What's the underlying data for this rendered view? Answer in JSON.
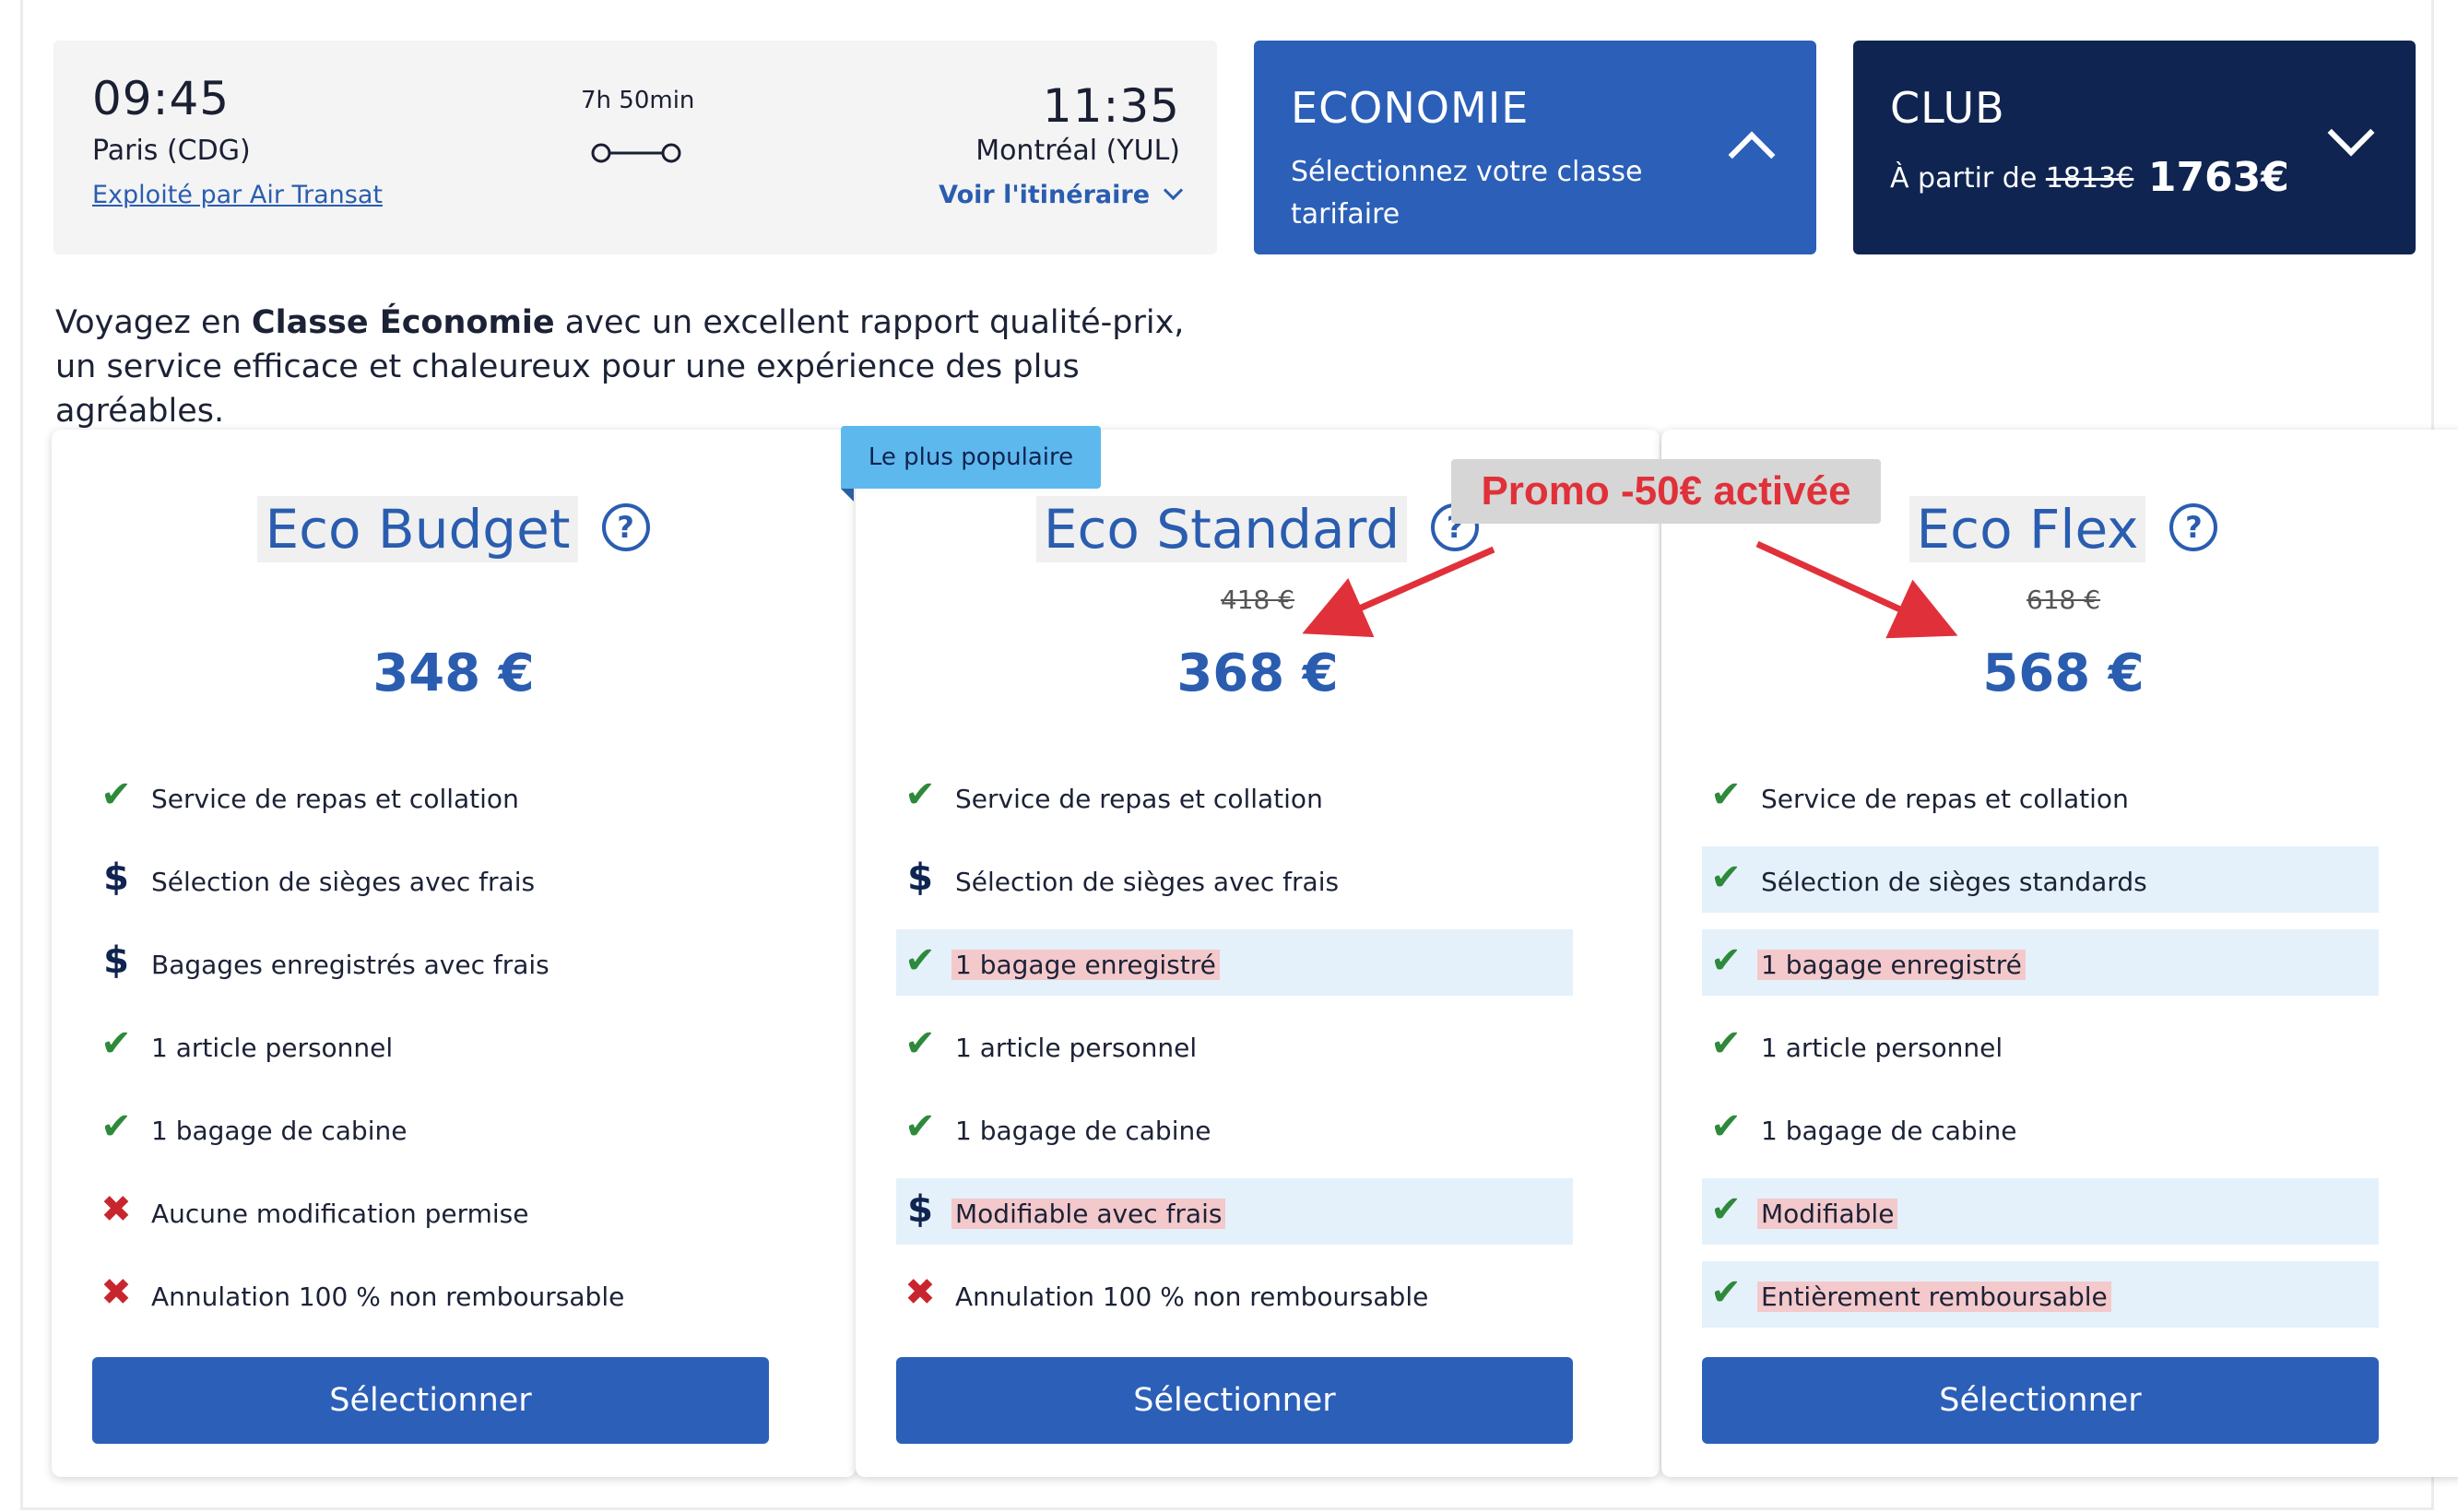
{
  "flight": {
    "departure_time": "09:45",
    "departure_city": "Paris (CDG)",
    "operated_by": "Exploité par Air Transat",
    "duration": "7h 50min",
    "arrival_time": "11:35",
    "arrival_city": "Montréal (YUL)",
    "itinerary_link": "Voir l'itinéraire"
  },
  "tabs": {
    "economy": {
      "title": "ECONOMIE",
      "subtitle": "Sélectionnez votre classe tarifaire",
      "expanded": true
    },
    "club": {
      "title": "CLUB",
      "prefix": "À partir de",
      "old_price": "1813€",
      "price": "1763€",
      "expanded": false
    }
  },
  "description": {
    "before": "Voyagez en ",
    "bold": "Classe Économie",
    "after": " avec un excellent rapport qualité-prix, un service efficace et chaleureux pour une expérience des plus agréables."
  },
  "badge": "Le plus populaire",
  "promo_annotation": "Promo -50€ activée",
  "select_label": "Sélectionner",
  "colors": {
    "primary": "#2b5fb8",
    "navy": "#0f2450",
    "check": "#2e8a3b",
    "cross": "#c8262e",
    "highlight": "#e4f1fa",
    "badge": "#5db8ee",
    "promo": "#e0313a"
  },
  "fares": [
    {
      "name": "Eco Budget",
      "old_price": "",
      "price": "348 €",
      "features": [
        {
          "icon": "check",
          "text": "Service de repas et collation",
          "highlight": false,
          "mark": false
        },
        {
          "icon": "dollar",
          "text": "Sélection de sièges avec frais",
          "highlight": false,
          "mark": false
        },
        {
          "icon": "dollar",
          "text": "Bagages enregistrés avec frais",
          "highlight": false,
          "mark": false
        },
        {
          "icon": "check",
          "text": "1 article personnel",
          "highlight": false,
          "mark": false
        },
        {
          "icon": "check",
          "text": "1 bagage de cabine",
          "highlight": false,
          "mark": false
        },
        {
          "icon": "cross",
          "text": "Aucune modification permise",
          "highlight": false,
          "mark": false
        },
        {
          "icon": "cross",
          "text": "Annulation 100 % non remboursable",
          "highlight": false,
          "mark": false
        }
      ]
    },
    {
      "name": "Eco Standard",
      "old_price": "418 €",
      "price": "368 €",
      "features": [
        {
          "icon": "check",
          "text": "Service de repas et collation",
          "highlight": false,
          "mark": false
        },
        {
          "icon": "dollar",
          "text": "Sélection de sièges avec frais",
          "highlight": false,
          "mark": false
        },
        {
          "icon": "check",
          "text": "1 bagage enregistré",
          "highlight": true,
          "mark": true
        },
        {
          "icon": "check",
          "text": "1 article personnel",
          "highlight": false,
          "mark": false
        },
        {
          "icon": "check",
          "text": "1 bagage de cabine",
          "highlight": false,
          "mark": false
        },
        {
          "icon": "dollar",
          "text": "Modifiable avec frais",
          "highlight": true,
          "mark": true
        },
        {
          "icon": "cross",
          "text": "Annulation 100 % non remboursable",
          "highlight": false,
          "mark": false
        }
      ]
    },
    {
      "name": "Eco Flex",
      "old_price": "618 €",
      "price": "568 €",
      "features": [
        {
          "icon": "check",
          "text": "Service de repas et collation",
          "highlight": false,
          "mark": false
        },
        {
          "icon": "check",
          "text": "Sélection de sièges standards",
          "highlight": true,
          "mark": false
        },
        {
          "icon": "check",
          "text": "1 bagage enregistré",
          "highlight": true,
          "mark": true
        },
        {
          "icon": "check",
          "text": "1 article personnel",
          "highlight": false,
          "mark": false
        },
        {
          "icon": "check",
          "text": "1 bagage de cabine",
          "highlight": false,
          "mark": false
        },
        {
          "icon": "check",
          "text": "Modifiable",
          "highlight": true,
          "mark": true
        },
        {
          "icon": "check",
          "text": "Entièrement remboursable",
          "highlight": true,
          "mark": true
        }
      ]
    }
  ]
}
